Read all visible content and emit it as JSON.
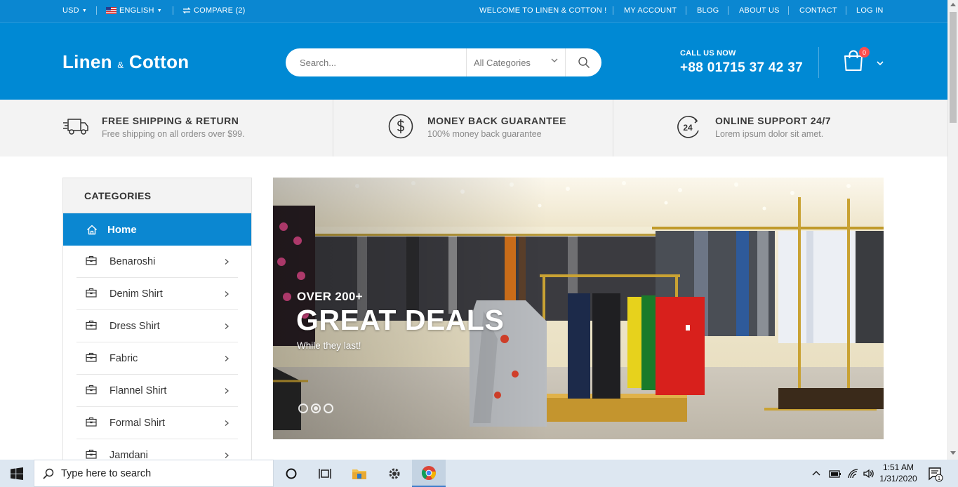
{
  "topbar": {
    "currency": "USD",
    "language": "ENGLISH",
    "compare": "COMPARE (2)",
    "welcome": "WELCOME TO LINEN & COTTON !",
    "links": [
      "MY ACCOUNT",
      "BLOG",
      "ABOUT US",
      "CONTACT",
      "LOG IN"
    ]
  },
  "header": {
    "logo_part1": "Linen",
    "logo_amp": "&",
    "logo_part2": "Cotton",
    "search_placeholder": "Search...",
    "category_select": "All Categories",
    "call_label": "CALL US NOW",
    "phone": "+88 01715 37 42 37",
    "cart_count": "0"
  },
  "features": [
    {
      "title": "FREE SHIPPING & RETURN",
      "subtitle": "Free shipping on all orders over $99.",
      "icon": "truck-icon"
    },
    {
      "title": "MONEY BACK GUARANTEE",
      "subtitle": "100% money back guarantee",
      "icon": "dollar-icon"
    },
    {
      "title": "ONLINE SUPPORT 24/7",
      "subtitle": "Lorem ipsum dolor sit amet.",
      "icon": "support-24-icon",
      "icon_text": "24"
    }
  ],
  "categories": {
    "heading": "CATEGORIES",
    "home": "Home",
    "items": [
      "Benaroshi",
      "Denim Shirt",
      "Dress Shirt",
      "Fabric",
      "Flannel Shirt",
      "Formal Shirt",
      "Jamdani"
    ]
  },
  "banner": {
    "line1": "OVER 200+",
    "line2": "GREAT DEALS",
    "line3": "While they last!",
    "slides": 3,
    "active_slide": 2
  },
  "taskbar": {
    "search_placeholder": "Type here to search",
    "time": "1:51 AM",
    "date": "1/31/2020",
    "notification_count": "1"
  },
  "colors": {
    "primary": "#0089d4",
    "topbar": "#0b87d1",
    "badge": "#ff4d4d",
    "feature_bg": "#f3f3f3"
  }
}
